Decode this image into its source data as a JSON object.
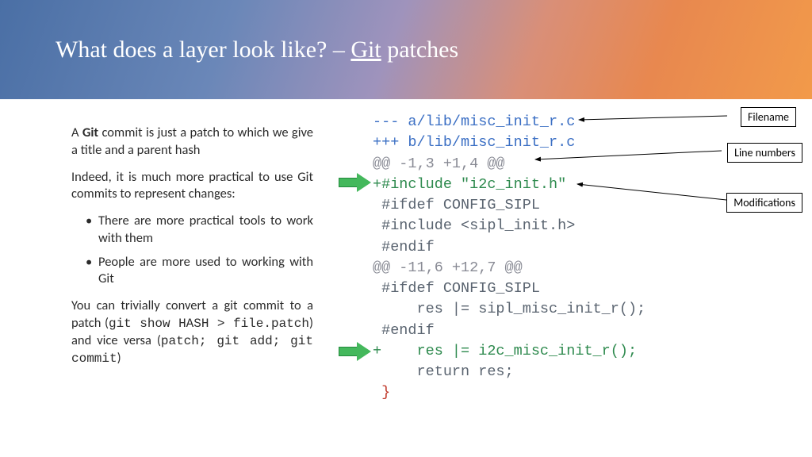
{
  "title": {
    "pre": "What does a layer look like? – ",
    "u": "Git",
    "post": " patches"
  },
  "left": {
    "p1a": "A ",
    "p1b": "Git",
    "p1c": " commit is just a patch to which we give a title and a parent hash",
    "p2": "Indeed, it is much more practical to use Git commits to represent changes:",
    "b1": "There are more practical tools to work with them",
    "b2": "People are more used to working with Git",
    "p3a": "You can trivially convert a git commit to a patch (",
    "p3b": "git show HASH > file.patch",
    "p3c": ") and vice versa (",
    "p3d": "patch; git add; git commit",
    "p3e": ")"
  },
  "code": {
    "l1": "--- a/lib/misc_init_r.c",
    "l2": "+++ b/lib/misc_init_r.c",
    "l3": "@@ -1,3 +1,4 @@",
    "l4": "+#include \"i2c_init.h\"",
    "l5": " #ifdef CONFIG_SIPL",
    "l6": " #include <sipl_init.h>",
    "l7": " #endif",
    "l8": "@@ -11,6 +12,7 @@",
    "l9": " #ifdef CONFIG_SIPL",
    "l10": "     res |= sipl_misc_init_r();",
    "l11": " #endif",
    "l12": "+    res |= i2c_misc_init_r();",
    "l13": "     return res;",
    "l14": " }"
  },
  "labels": {
    "filename": "Filename",
    "lines": "Line numbers",
    "mods": "Modifications"
  }
}
